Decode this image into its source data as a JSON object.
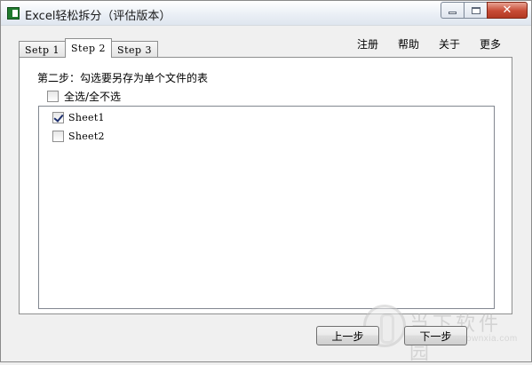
{
  "window": {
    "title": "Excel轻松拆分（评估版本）",
    "icon": "excel-icon"
  },
  "tabs": [
    {
      "label": "Setp 1",
      "active": false
    },
    {
      "label": "Step 2",
      "active": true
    },
    {
      "label": "Step 3",
      "active": false
    }
  ],
  "menu": {
    "register": "注册",
    "help": "帮助",
    "about": "关于",
    "more": "更多"
  },
  "step2": {
    "instruction": "第二步：勾选要另存为单个文件的表",
    "select_all": {
      "label": "全选/全不选",
      "checked": false
    },
    "sheets": [
      {
        "label": "Sheet1",
        "checked": true
      },
      {
        "label": "Sheet2",
        "checked": false
      }
    ]
  },
  "buttons": {
    "prev": "上一步",
    "next": "下一步"
  },
  "watermark": {
    "text": "当下软件园",
    "url": "www.downxia.com"
  },
  "colors": {
    "close_button": "#c74a34",
    "excel_icon": "#1f7a2e",
    "checkmark": "#1d2f6e"
  }
}
